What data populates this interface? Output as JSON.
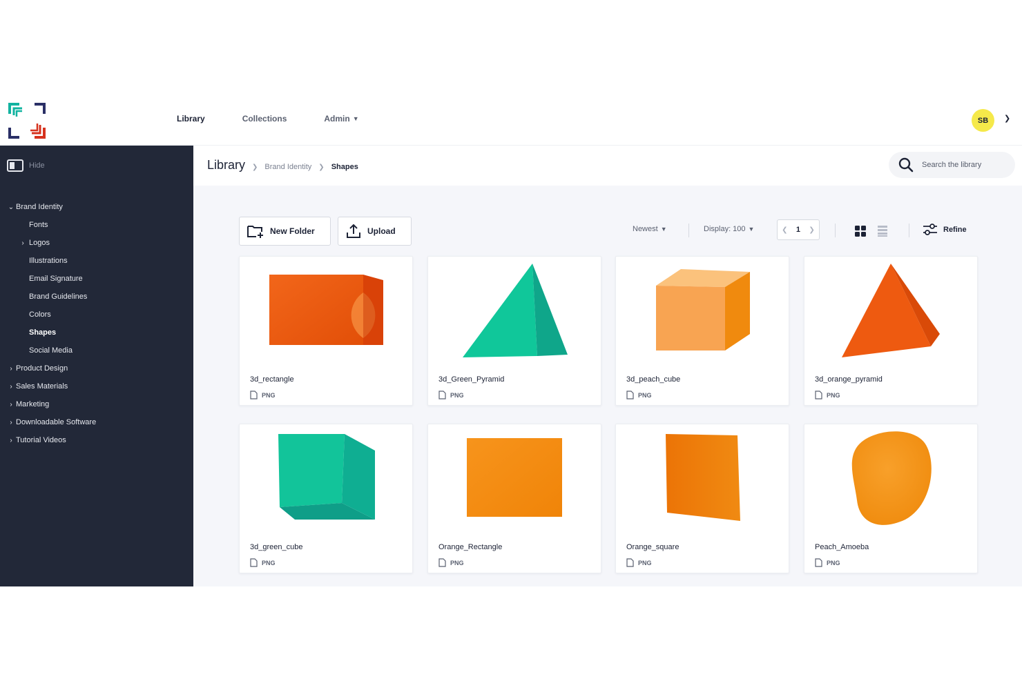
{
  "topnav": {
    "items": [
      {
        "label": "Library",
        "active": true
      },
      {
        "label": "Collections",
        "active": false
      },
      {
        "label": "Admin",
        "active": false,
        "has_dropdown": true
      }
    ],
    "avatar_initials": "SB",
    "avatar_color": "#f5e94a"
  },
  "sidebar": {
    "hide_label": "Hide",
    "tree": [
      {
        "label": "Brand Identity",
        "expanded": true
      },
      {
        "label": "Fonts"
      },
      {
        "label": "Logos"
      },
      {
        "label": "Illustrations"
      },
      {
        "label": "Email Signature"
      },
      {
        "label": "Brand Guidelines"
      },
      {
        "label": "Colors"
      },
      {
        "label": "Shapes"
      },
      {
        "label": "Social Media"
      },
      {
        "label": "Product Design"
      },
      {
        "label": "Sales Materials"
      },
      {
        "label": "Marketing"
      },
      {
        "label": "Downloadable Software"
      },
      {
        "label": "Tutorial Videos"
      }
    ]
  },
  "breadcrumb": {
    "root": "Library",
    "items": [
      "Brand Identity",
      "Shapes"
    ]
  },
  "search": {
    "placeholder": "Search the library"
  },
  "toolbar": {
    "new_folder": "New Folder",
    "upload": "Upload",
    "sort": "Newest",
    "display": "Display: 100",
    "page": "1",
    "refine": "Refine"
  },
  "assets": [
    {
      "name": "3d_rectangle",
      "type": "PNG",
      "shape": "rectangle-3d",
      "color": "#ee5a10"
    },
    {
      "name": "3d_Green_Pyramid",
      "type": "PNG",
      "shape": "pyramid-3d",
      "color": "#12c49a"
    },
    {
      "name": "3d_peach_cube",
      "type": "PNG",
      "shape": "cube-3d",
      "color": "#f7a14f"
    },
    {
      "name": "3d_orange_pyramid",
      "type": "PNG",
      "shape": "pyramid-3d",
      "color": "#ee5a10"
    },
    {
      "name": "3d_green_cube",
      "type": "PNG",
      "shape": "cube-3d",
      "color": "#12c49a"
    },
    {
      "name": "Orange_Rectangle",
      "type": "PNG",
      "shape": "rectangle",
      "color": "#f5880f"
    },
    {
      "name": "Orange_square",
      "type": "PNG",
      "shape": "square-skewed",
      "color": "#ef7c08"
    },
    {
      "name": "Peach_Amoeba",
      "type": "PNG",
      "shape": "amoeba",
      "color": "#f5900f"
    }
  ]
}
